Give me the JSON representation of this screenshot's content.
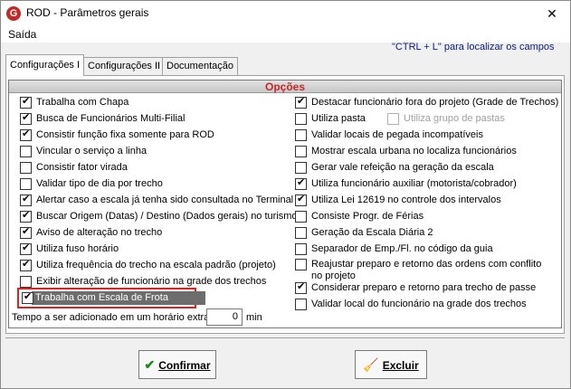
{
  "window": {
    "title": "ROD - Parâmetros gerais",
    "close_glyph": "✕",
    "app_icon_glyph": "G"
  },
  "menu": {
    "items": [
      "Saída"
    ]
  },
  "hint": "\"CTRL + L\" para localizar os campos",
  "tabs": [
    "Configurações I",
    "Configurações II",
    "Documentação"
  ],
  "group_title": "Opções",
  "left_options": [
    {
      "label": "Trabalha com Chapa",
      "checked": true
    },
    {
      "label": "Busca de Funcionários Multi-Filial",
      "checked": true
    },
    {
      "label": "Consistir função fixa somente para ROD",
      "checked": true
    },
    {
      "label": "Vincular o serviço a linha",
      "checked": false
    },
    {
      "label": "Consistir fator virada",
      "checked": false
    },
    {
      "label": "Validar tipo de dia por trecho",
      "checked": false
    },
    {
      "label": "Alertar caso a escala já tenha sido consultada no Terminal",
      "checked": true
    },
    {
      "label": "Buscar Origem (Datas) / Destino (Dados gerais) no turismo",
      "checked": true
    },
    {
      "label": "Aviso de alteração no trecho",
      "checked": true
    },
    {
      "label": "Utiliza fuso horário",
      "checked": true
    },
    {
      "label": "Utiliza frequência do trecho na escala padrão (projeto)",
      "checked": true
    },
    {
      "label": "Exibir alteração de funcionário na grade dos trechos",
      "checked": false
    },
    {
      "label": "Trabalha com Escala de Frota",
      "checked": true,
      "highlighted": true
    }
  ],
  "right_options": [
    {
      "label": "Destacar funcionário fora do projeto (Grade de Trechos)",
      "checked": true
    },
    {
      "label": "Utiliza pasta",
      "checked": false
    },
    {
      "label": "Validar locais de pegada incompatíveis",
      "checked": false
    },
    {
      "label": "Mostrar escala urbana no localiza funcionários",
      "checked": false
    },
    {
      "label": "Gerar vale refeição na geração da escala",
      "checked": false
    },
    {
      "label": "Utiliza funcionário auxiliar (motorista/cobrador)",
      "checked": true
    },
    {
      "label": "Utiliza Lei 12619 no controle dos intervalos",
      "checked": true
    },
    {
      "label": "Consiste Progr. de Férias",
      "checked": false
    },
    {
      "label": "Geração da Escala Diária 2",
      "checked": false
    },
    {
      "label": "Separador de Emp./Fl. no código da guia",
      "checked": false
    },
    {
      "label": "Reajustar preparo e retorno das ordens com conflito no projeto",
      "checked": false
    },
    {
      "label": "Considerar preparo e retorno para trecho de passe",
      "checked": true
    },
    {
      "label": "Validar local do funcionário na grade dos trechos",
      "checked": false
    }
  ],
  "sub_option": {
    "label": "Utiliza grupo de pastas",
    "checked": false,
    "disabled": true
  },
  "extra_time": {
    "label": "Tempo a ser adicionado em um horário extra",
    "value": "0",
    "unit": "min"
  },
  "buttons": {
    "confirm": "Confirmar",
    "cancel": "Excluir"
  },
  "icons": {
    "confirm": "checkmark-icon",
    "cancel": "broom-icon"
  }
}
